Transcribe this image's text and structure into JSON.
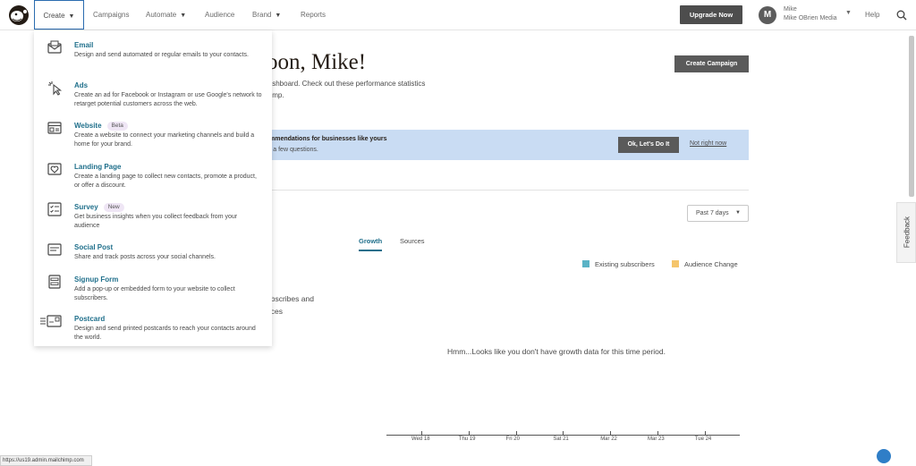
{
  "nav": {
    "create": "Create",
    "campaigns": "Campaigns",
    "automate": "Automate",
    "audience": "Audience",
    "brand": "Brand",
    "reports": "Reports",
    "upgrade": "Upgrade Now",
    "avatar_initial": "M",
    "user_name": "Mike",
    "user_org": "Mike OBrien Media",
    "help": "Help"
  },
  "main": {
    "greeting": "oon, Mike!",
    "intro_line1": "lashboard. Check out these performance statistics",
    "intro_line2": "himp.",
    "create_campaign": "Create Campaign",
    "banner_title": "mmendations for businesses like yours",
    "banner_sub": "r a few questions.",
    "banner_ok": "Ok, Let's Do It",
    "banner_not_now": "Not right now",
    "period": "Past 7 days",
    "tab_growth": "Growth",
    "tab_sources": "Sources",
    "legend_existing": "Existing subscribers",
    "legend_change": "Audience Change",
    "partial_1": "ubscribes and",
    "partial_2": "nces",
    "empty_message": "Hmm...Looks like you don't have growth data for this time period.",
    "axis_labels": [
      "Wed 18",
      "Thu 19",
      "Fri 20",
      "Sat 21",
      "Mar 22",
      "Mar 23",
      "Tue 24"
    ]
  },
  "menu": {
    "items": [
      {
        "title": "Email",
        "desc": "Design and send automated or regular emails to your contacts.",
        "icon": "email-icon"
      },
      {
        "title": "Ads",
        "desc": "Create an ad for Facebook or Instagram or use Google's network to retarget potential customers across the web.",
        "icon": "cursor-click-icon"
      },
      {
        "title": "Website",
        "badge": "Beta",
        "desc": "Create a website to connect your marketing channels and build a home for your brand.",
        "icon": "browser-window-icon"
      },
      {
        "title": "Landing Page",
        "desc": "Create a landing page to collect new contacts, promote a product, or offer a discount.",
        "icon": "heart-page-icon"
      },
      {
        "title": "Survey",
        "badge": "New",
        "desc": "Get business insights when you collect feedback from your audience",
        "icon": "checklist-icon"
      },
      {
        "title": "Social Post",
        "desc": "Share and track posts across your social channels.",
        "icon": "social-post-icon"
      },
      {
        "title": "Signup Form",
        "desc": "Add a pop-up or embedded form to your website to collect subscribers.",
        "icon": "form-icon"
      },
      {
        "title": "Postcard",
        "desc": "Design and send printed postcards to reach your contacts around the world.",
        "icon": "postcard-icon"
      }
    ]
  },
  "side": {
    "feedback": "Feedback",
    "status_url": "https://us19.admin.mailchimp.com"
  },
  "colors": {
    "accent_teal": "#1f6f8b",
    "legend_existing": "#5ab3c6",
    "legend_change": "#f5c56b",
    "banner_bg": "#c9dcf3",
    "dark_button": "#4d4d4d"
  }
}
